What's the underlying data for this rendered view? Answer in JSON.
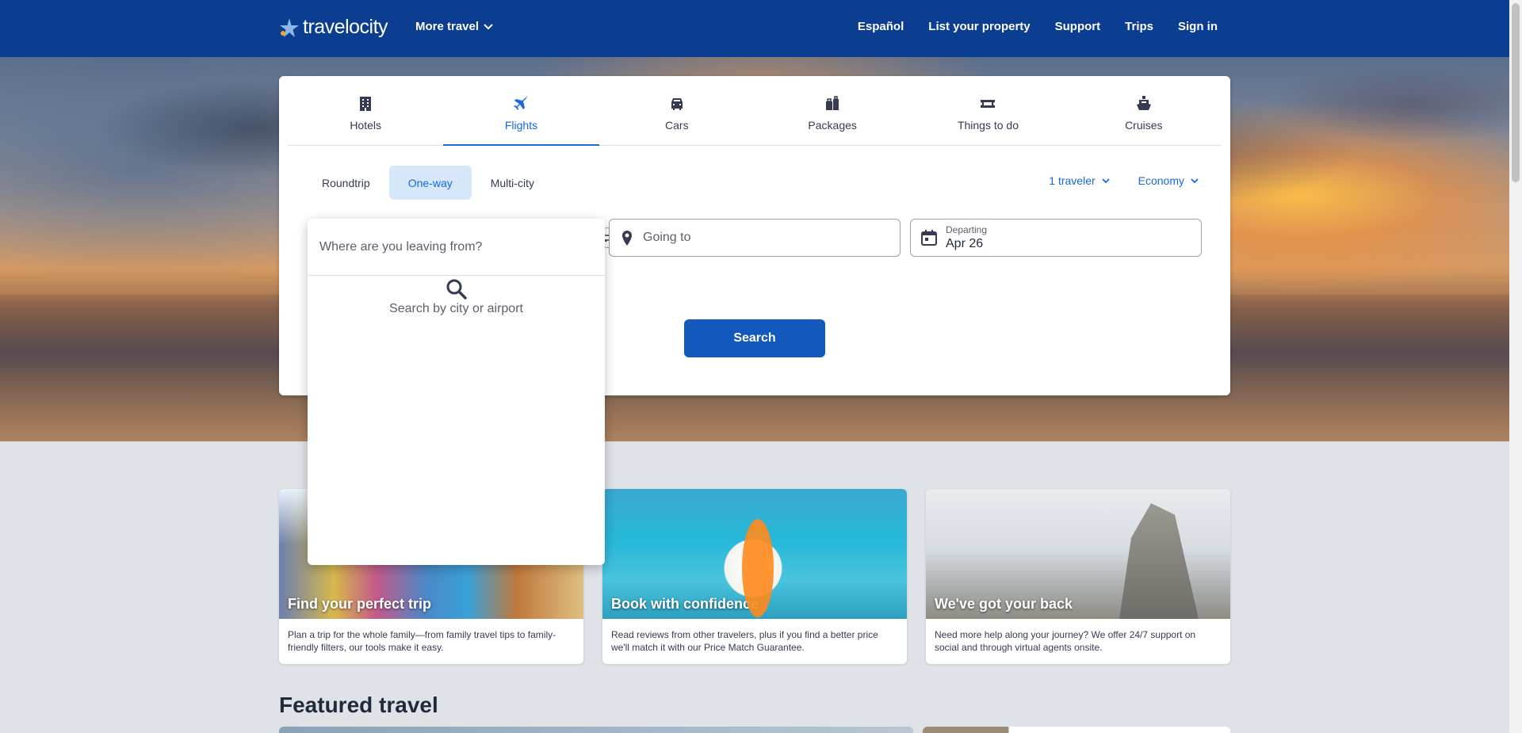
{
  "header": {
    "logo_text": "travelocity",
    "more_travel": "More travel",
    "nav": [
      "Español",
      "List your property",
      "Support",
      "Trips",
      "Sign in"
    ]
  },
  "search": {
    "tabs": [
      {
        "label": "Hotels",
        "icon": "building-icon"
      },
      {
        "label": "Flights",
        "icon": "airplane-icon",
        "active": true
      },
      {
        "label": "Cars",
        "icon": "car-icon"
      },
      {
        "label": "Packages",
        "icon": "suitcase-icon"
      },
      {
        "label": "Things to do",
        "icon": "ticket-icon"
      },
      {
        "label": "Cruises",
        "icon": "ship-icon"
      }
    ],
    "trip_types": [
      "Roundtrip",
      "One-way",
      "Multi-city"
    ],
    "active_trip_type": "One-way",
    "travelers": "1 traveler",
    "cabin": "Economy",
    "going_to_placeholder": "Going to",
    "departing_label": "Departing",
    "departing_value": "Apr 26",
    "search_button": "Search"
  },
  "dropdown": {
    "placeholder": "Where are you leaving from?",
    "hint": "Search by city or airport"
  },
  "promos": [
    {
      "title": "Find your perfect trip",
      "desc": "Plan a trip for the whole family—from family travel tips to family-friendly filters, our tools make it easy."
    },
    {
      "title": "Book with confidence",
      "desc": "Read reviews from other travelers, plus if you find a better price we'll match it with our Price Match Guarantee."
    },
    {
      "title": "We've got your back",
      "desc": "Need more help along your journey? We offer 24/7 support on social and through virtual agents onsite."
    }
  ],
  "featured_title": "Featured travel",
  "colors": {
    "brand": "#0b3d91",
    "accent": "#1668e3",
    "button": "#1358bd"
  }
}
